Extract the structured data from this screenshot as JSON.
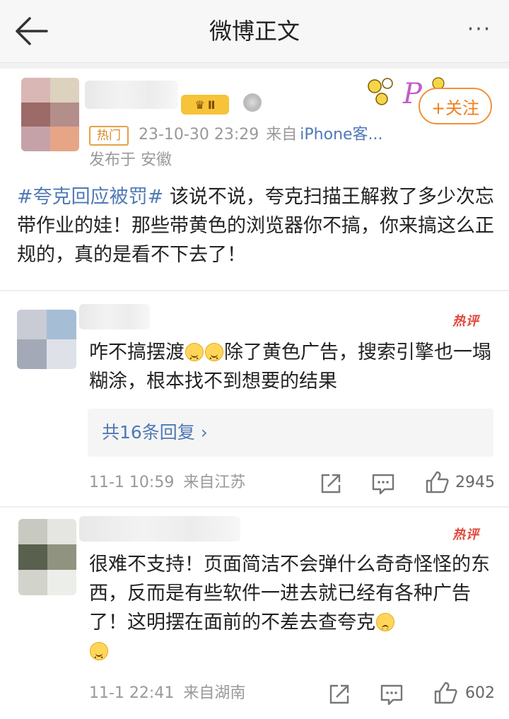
{
  "header": {
    "title": "微博正文",
    "more_label": "···"
  },
  "post": {
    "hot_tag": "热门",
    "time": "23-10-30 23:29",
    "from_label": "来自",
    "device": "iPhone客...",
    "location": "发布于 安徽",
    "badge_level": "Ⅱ",
    "follow_label": "+关注",
    "hashtag": "#夸克回应被罚#",
    "text": "该说不说，夸克扫描王解救了多少次忘带作业的娃！那些带黄色的浏览器你不搞，你来搞这么正规的，真的是看不下去了！"
  },
  "comments": [
    {
      "hot_label": "热评",
      "text_a": "咋不搞摆渡",
      "text_b": "除了黄色广告，搜索引擎也一塌糊涂，根本找不到想要的结果",
      "replies_label": "共16条回复 ›",
      "time": "11-1 10:59",
      "location": "来自江苏",
      "likes": "2945"
    },
    {
      "hot_label": "热评",
      "text_a": "很难不支持！页面简洁不会弹什么奇奇怪怪的东西，反而是有些软件一进去就已经有各种广告了！这明摆在面前的不差去查夸克",
      "time": "11-1 22:41",
      "location": "来自湖南",
      "likes": "602"
    }
  ],
  "icons": {
    "back": "back-arrow-icon",
    "share": "share-icon",
    "comment": "comment-icon",
    "like": "thumbs-up-icon",
    "emoji_smile": "smile-emoji-icon",
    "emoji_cry": "cry-emoji-icon"
  },
  "colors": {
    "link": "#4f79b5",
    "accent": "#f07e1d",
    "hot": "#e2463a"
  }
}
